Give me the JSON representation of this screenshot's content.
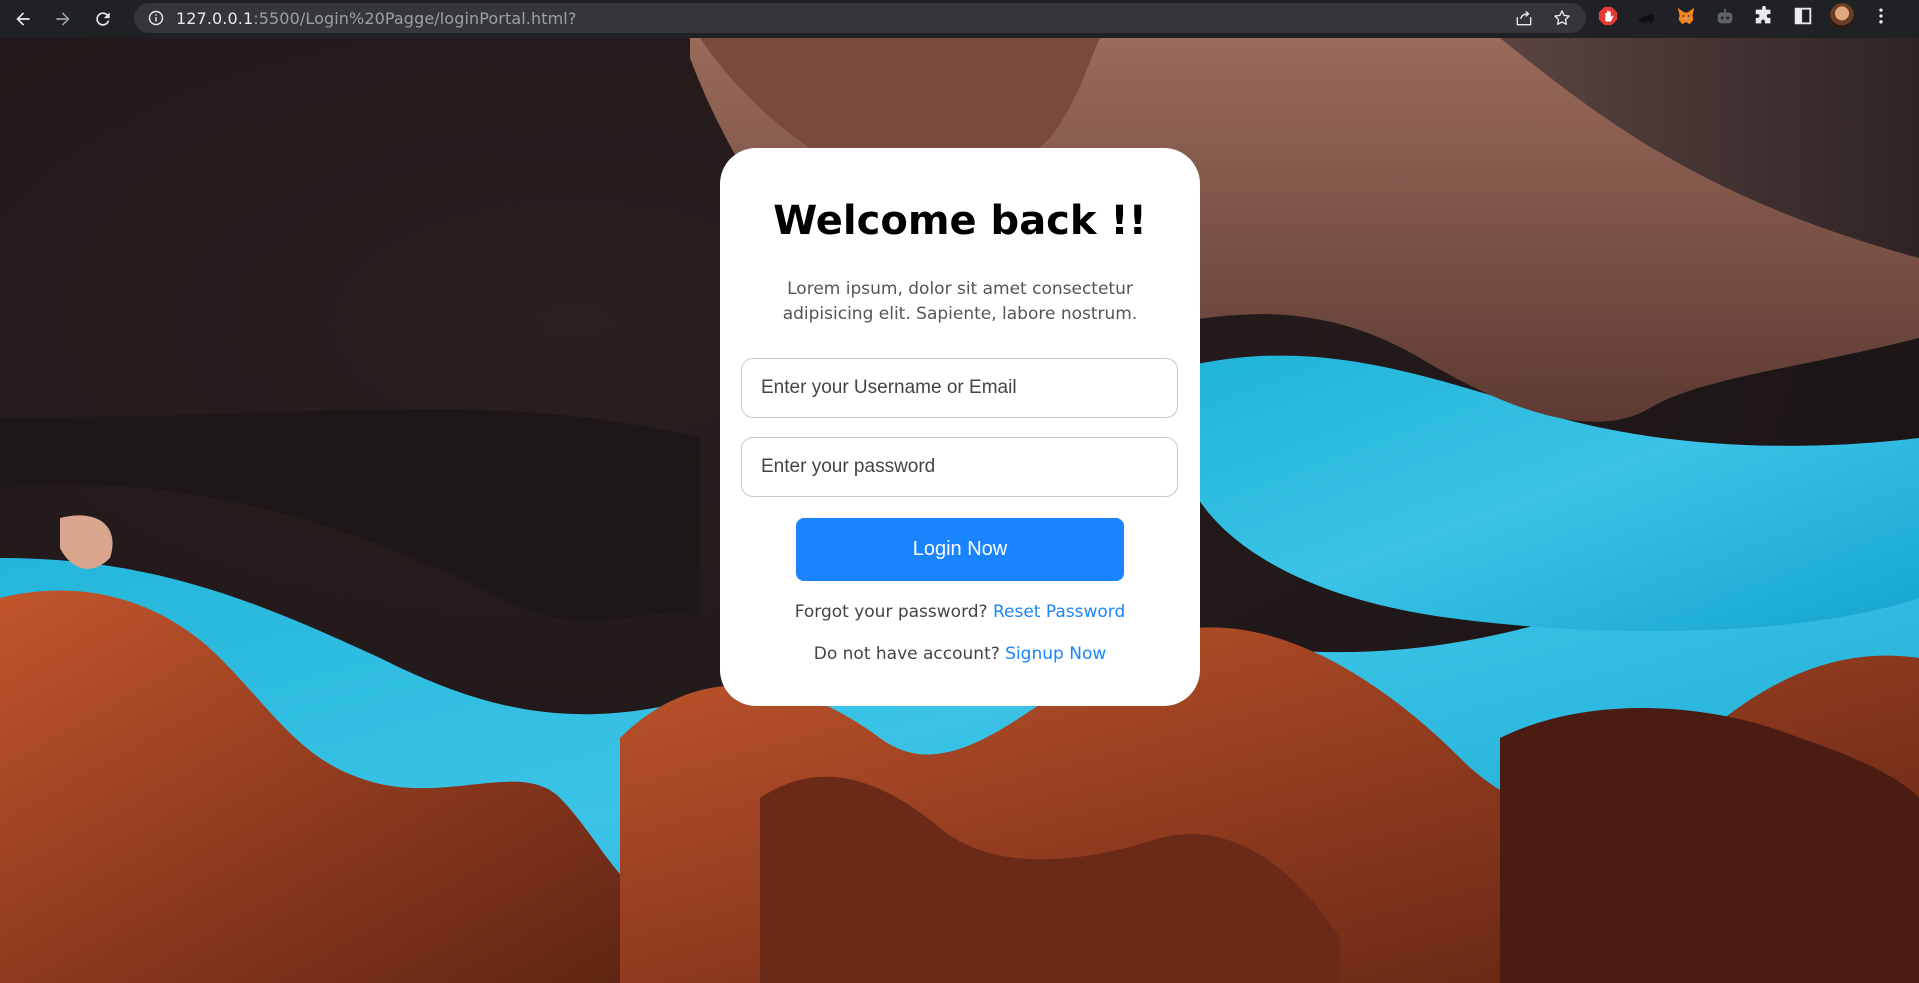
{
  "browser": {
    "url_host": "127.0.0.1",
    "url_rest": ":5500/Login%20Pagge/loginPortal.html?",
    "icons": {
      "back": "arrow-left-icon",
      "forward": "arrow-right-icon",
      "reload": "reload-icon",
      "site_info": "info-icon",
      "share": "share-icon",
      "bookmark": "star-icon",
      "extensions": "puzzle-icon",
      "side_panel": "side-panel-icon",
      "menu": "kebab-menu-icon"
    }
  },
  "login_card": {
    "title": "Welcome back !!",
    "description": "Lorem ipsum, dolor sit amet consectetur adipisicing elit. Sapiente, labore nostrum.",
    "username_placeholder": "Enter your Username or Email",
    "password_placeholder": "Enter your password",
    "login_button": "Login Now",
    "forgot_text": "Forgot your password?",
    "reset_link": "Reset Password",
    "no_account_text": "Do not have account?",
    "signup_link": "Signup Now"
  },
  "colors": {
    "accent": "#1a84ff",
    "card_bg": "#ffffff",
    "browser_bg": "#202124"
  }
}
